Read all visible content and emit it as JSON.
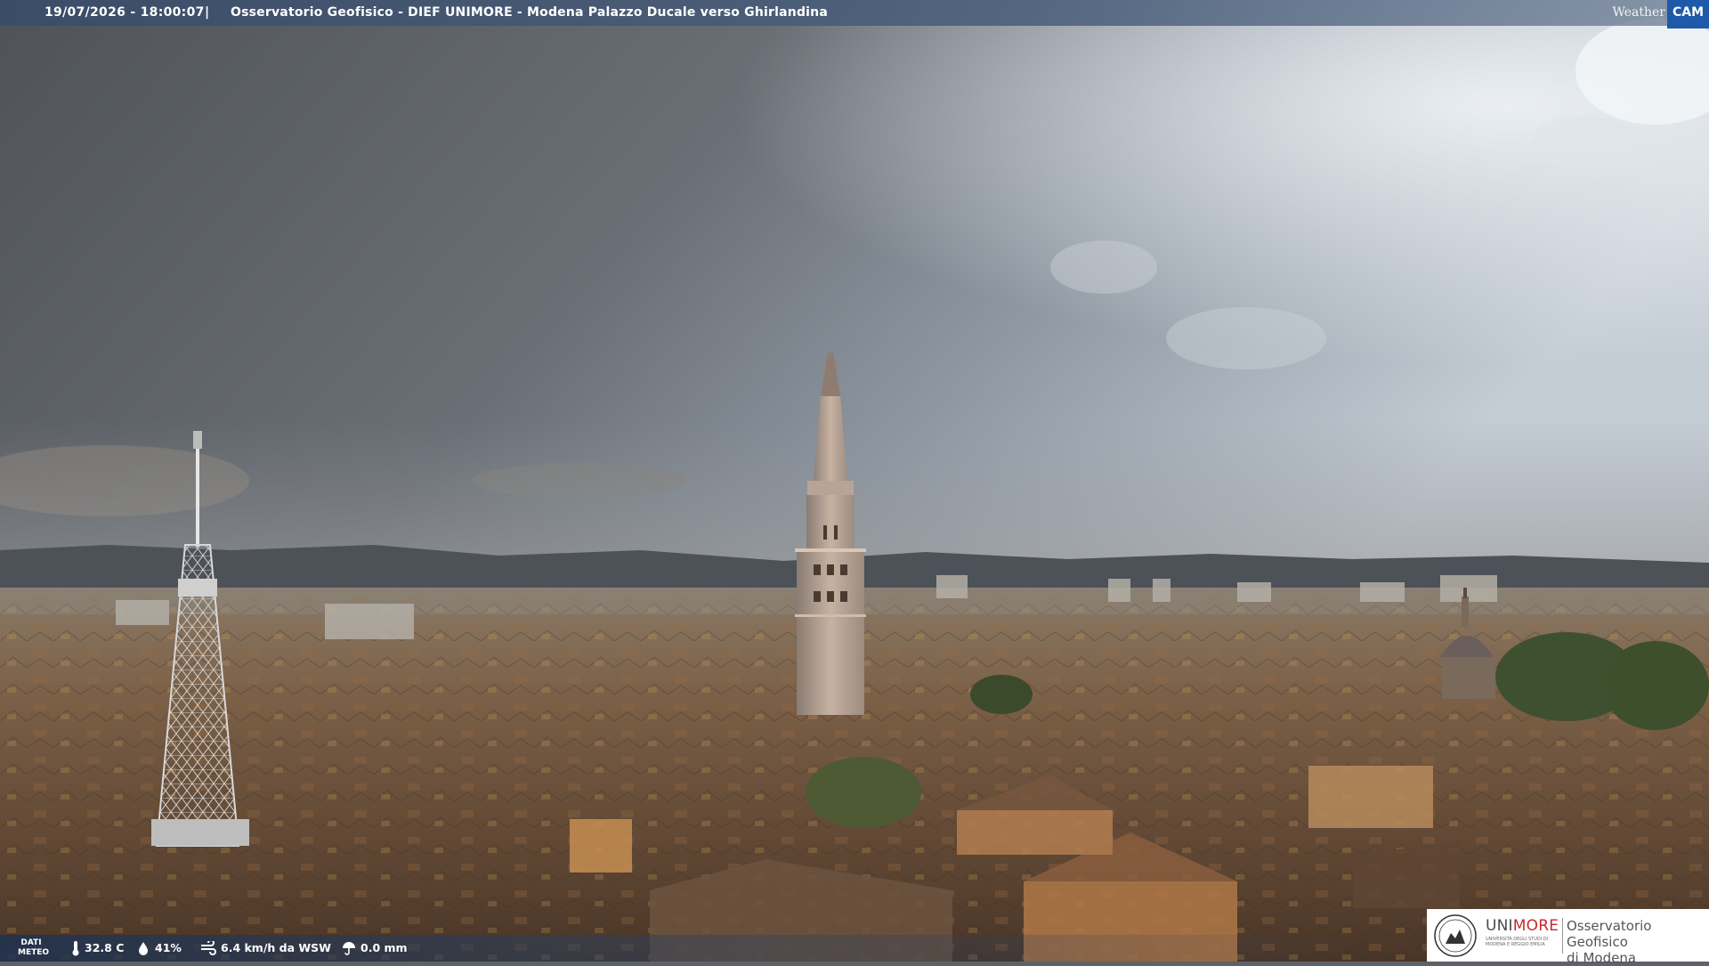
{
  "header": {
    "timestamp": "19/07/2026 - 18:00:07",
    "separator": "|",
    "title": "Osservatorio Geofisico - DIEF UNIMORE - Modena Palazzo Ducale verso Ghirlandina"
  },
  "brand": {
    "weather": "Weather",
    "cam": "CAM",
    "accent_color": "#1e5aa8"
  },
  "weather_data": {
    "label": "DATI METEO",
    "temperature": "32.8 C",
    "humidity": "41%",
    "wind": "6.4 km/h da WSW",
    "rain": "0.0 mm",
    "icons": [
      "thermometer-icon",
      "humidity-drop-icon",
      "wind-icon",
      "rain-umbrella-icon"
    ]
  },
  "institution": {
    "uni": "UNI",
    "more": "MORE",
    "subtitle": "UNIVERSITÀ DEGLI STUDI DI MODENA E REGGIO EMILIA",
    "observatory": "Osservatorio Geofisico",
    "city": "di Modena",
    "brand_red": "#c9292e"
  }
}
